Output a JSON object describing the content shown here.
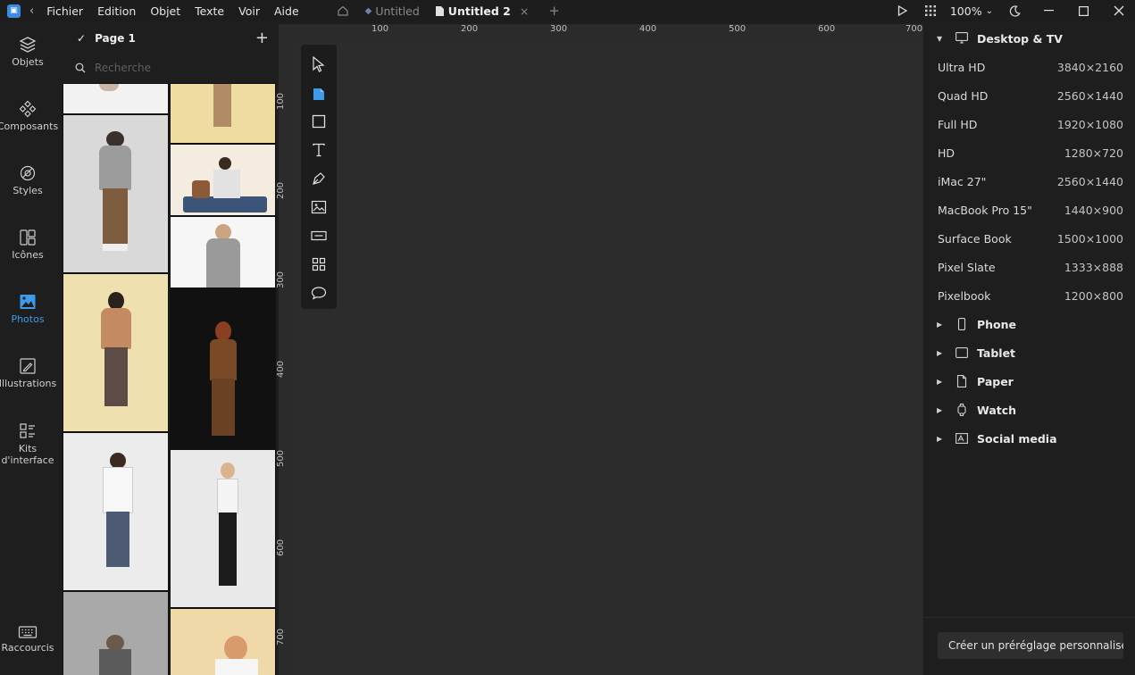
{
  "menu": {
    "items": [
      "Fichier",
      "Edition",
      "Objet",
      "Texte",
      "Voir",
      "Aide"
    ]
  },
  "tabs": [
    {
      "label": "Untitled",
      "active": false
    },
    {
      "label": "Untitled 2",
      "active": true
    }
  ],
  "window": {
    "zoom": "100%",
    "close_glyph": "×",
    "add_glyph": "+"
  },
  "rail": {
    "items": [
      {
        "label": "Objets",
        "icon": "layers-icon"
      },
      {
        "label": "Composants",
        "icon": "components-icon"
      },
      {
        "label": "Styles",
        "icon": "styles-icon"
      },
      {
        "label": "Icônes",
        "icon": "icons-icon"
      },
      {
        "label": "Photos",
        "icon": "photos-icon",
        "active": true
      },
      {
        "label": "Illustrations",
        "icon": "illustrations-icon"
      },
      {
        "label": "Kits\nd'interface",
        "icon": "ui-kits-icon"
      },
      {
        "label": "Raccourcis",
        "icon": "keyboard-icon"
      }
    ]
  },
  "panel": {
    "page_name": "Page 1",
    "search_placeholder": "Recherche"
  },
  "rulers": {
    "top": [
      "100",
      "200",
      "300",
      "400",
      "500",
      "600",
      "700"
    ],
    "left": [
      "100",
      "200",
      "300",
      "400",
      "500",
      "600",
      "700"
    ]
  },
  "presets": {
    "desktop": {
      "title": "Desktop & TV",
      "items": [
        {
          "name": "Ultra HD",
          "dims": "3840×2160"
        },
        {
          "name": "Quad HD",
          "dims": "2560×1440"
        },
        {
          "name": "Full HD",
          "dims": "1920×1080"
        },
        {
          "name": "HD",
          "dims": "1280×720"
        },
        {
          "name": "iMac 27\"",
          "dims": "2560×1440"
        },
        {
          "name": "MacBook Pro 15\"",
          "dims": "1440×900"
        },
        {
          "name": "Surface Book",
          "dims": "1500×1000"
        },
        {
          "name": "Pixel Slate",
          "dims": "1333×888"
        },
        {
          "name": "Pixelbook",
          "dims": "1200×800"
        }
      ]
    },
    "categories": [
      "Phone",
      "Tablet",
      "Paper",
      "Watch",
      "Social media"
    ],
    "create_button": "Créer un préréglage personnalisé"
  },
  "colors": {
    "accent": "#3d9be9",
    "canvas": "#2c2c2c",
    "panel": "#1e1e1e"
  }
}
